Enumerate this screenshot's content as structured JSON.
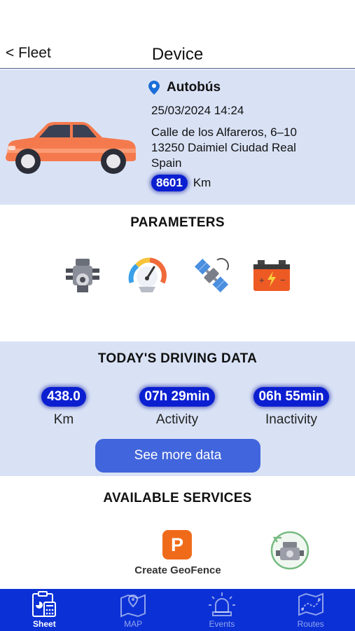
{
  "header": {
    "back_label": "< Fleet",
    "title": "Device"
  },
  "device": {
    "name": "Autobús",
    "datetime": "25/03/2024 14:24",
    "address": [
      "Calle de los Alfareros, 6–10",
      "13250 Daimiel Ciudad Real",
      "Spain"
    ],
    "odometer": "8601",
    "odometer_unit": "Km",
    "car_color": "#f47a4e"
  },
  "parameters": {
    "title": "PARAMETERS",
    "icons": [
      "engine-icon",
      "speedometer-icon",
      "satellite-icon",
      "battery-icon"
    ]
  },
  "driving": {
    "title": "TODAY'S DRIVING DATA",
    "stats": [
      {
        "value": "438.0",
        "label": "Km"
      },
      {
        "value": "07h 29min",
        "label": "Activity"
      },
      {
        "value": "06h 55min",
        "label": "Inactivity"
      }
    ],
    "button_label": "See more data"
  },
  "services": {
    "title": "AVAILABLE SERVICES",
    "geofence_letter": "P",
    "geofence_label": "Create GeoFence"
  },
  "tabs": [
    {
      "label": "Sheet",
      "icon": "sheet-icon",
      "active": true
    },
    {
      "label": "MAP",
      "icon": "map-icon",
      "active": false
    },
    {
      "label": "Events",
      "icon": "siren-icon",
      "active": false
    },
    {
      "label": "Routes",
      "icon": "routes-icon",
      "active": false
    }
  ],
  "colors": {
    "accent_blue": "#0b31d6",
    "card_bg": "#d9e2f5",
    "button_blue": "#4165dc",
    "pill_blue": "#0b1fd1",
    "geofence_orange": "#ef6b1a"
  }
}
